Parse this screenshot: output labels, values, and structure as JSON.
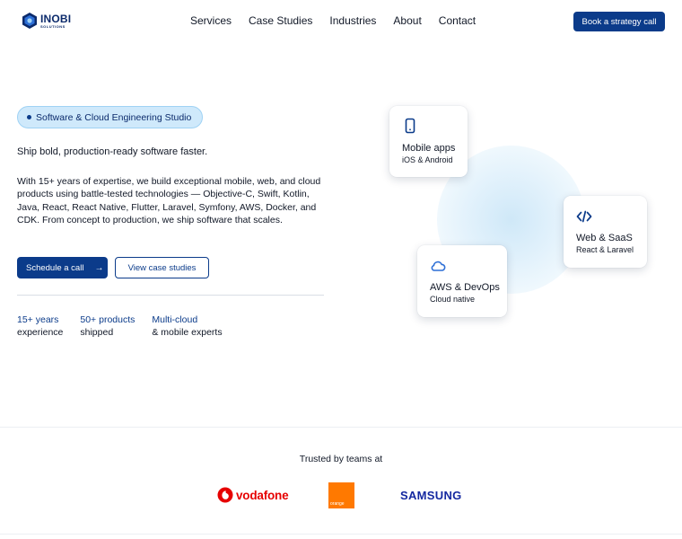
{
  "header": {
    "logo_name": "INOBI",
    "logo_sub": "SOLUTIONS",
    "nav": [
      {
        "label": "Services"
      },
      {
        "label": "Case Studies"
      },
      {
        "label": "Industries"
      },
      {
        "label": "About"
      },
      {
        "label": "Contact"
      }
    ],
    "cta_label": "Book a strategy call"
  },
  "hero": {
    "badge": "Software & Cloud Engineering Studio",
    "tagline": "Ship bold, production-ready software faster.",
    "description": "With 15+ years of expertise, we build exceptional mobile, web, and cloud products using battle-tested technologies — Objective-C, Swift, Kotlin, Java, React, React Native, Flutter, Laravel, Symfony, AWS, Docker, and CDK. From concept to production, we ship software that scales.",
    "primary_button": "Schedule a call",
    "primary_button_icon": "arrow-right-icon",
    "secondary_button": "View case studies",
    "stats": [
      {
        "value": "15+ years",
        "label": "experience"
      },
      {
        "value": "50+ products",
        "label": "shipped"
      },
      {
        "value": "Multi-cloud",
        "label": "& mobile experts"
      }
    ]
  },
  "cards": {
    "mobile": {
      "icon": "smartphone-icon",
      "title": "Mobile apps",
      "subtitle": "iOS & Android"
    },
    "web": {
      "icon": "code-icon",
      "title": "Web & SaaS",
      "subtitle": "React & Laravel"
    },
    "aws": {
      "icon": "cloud-icon",
      "title": "AWS & DevOps",
      "subtitle": "Cloud native"
    }
  },
  "trusted": {
    "title": "Trusted by teams at",
    "logos": [
      {
        "name": "vodafone",
        "text": "vodafone"
      },
      {
        "name": "orange",
        "text": "orange"
      },
      {
        "name": "samsung",
        "text": "SAMSUNG"
      }
    ]
  },
  "colors": {
    "brand_navy": "#0b3b8a",
    "badge_bg": "#cfe9fb",
    "vodafone_red": "#e60000",
    "orange_brand": "#ff7900",
    "samsung_blue": "#1428a0"
  }
}
